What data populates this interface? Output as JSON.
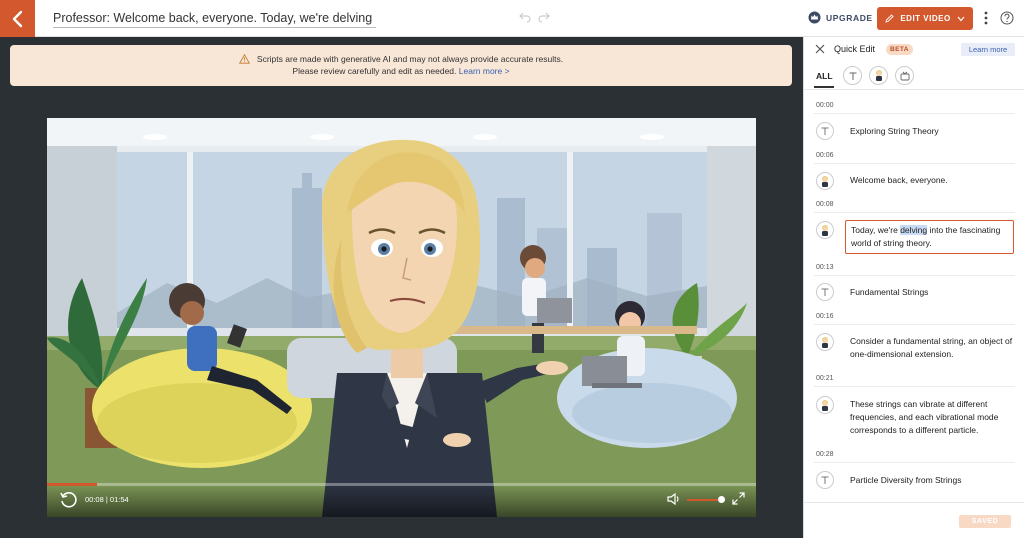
{
  "header": {
    "title": "Professor: Welcome back, everyone. Today, we're delving into th...",
    "upgrade_label": "UPGRADE",
    "edit_video_label": "EDIT VIDEO"
  },
  "notice": {
    "line1": "Scripts are made with generative AI and may not always provide accurate results.",
    "line2": "Please review carefully and edit as needed.",
    "link": "Learn more >"
  },
  "player": {
    "current_time": "00:08",
    "duration": "01:54",
    "separator": " | ",
    "progress_fraction": 0.07,
    "volume_fraction": 0.9
  },
  "quick_edit": {
    "title": "Quick Edit",
    "beta": "BETA",
    "learn_more": "Learn more",
    "filters": {
      "all": "ALL"
    },
    "items": [
      {
        "time": "00:00",
        "type": "text",
        "text": "Exploring String Theory"
      },
      {
        "time": "00:06",
        "type": "avatar",
        "text": "Welcome back, everyone."
      },
      {
        "time": "00:08",
        "type": "avatar",
        "text_before": "Today, we're ",
        "text_highlight": "delving",
        "text_after": " into the fascinating world of string theory.",
        "active": true
      },
      {
        "time": "00:13",
        "type": "text",
        "text": "Fundamental Strings"
      },
      {
        "time": "00:16",
        "type": "avatar",
        "text": "Consider a fundamental string, an object of one-dimensional extension."
      },
      {
        "time": "00:21",
        "type": "avatar",
        "text": "These strings can vibrate at different frequencies, and each vibrational mode corresponds to a different particle."
      },
      {
        "time": "00:28",
        "type": "text",
        "text": "Particle Diversity from Strings"
      }
    ],
    "save_label": "SAVED"
  },
  "colors": {
    "accent": "#d4582e",
    "notice_bg": "#f8e6d7",
    "link": "#3b5fb1",
    "stage_bg": "#2b3035"
  }
}
